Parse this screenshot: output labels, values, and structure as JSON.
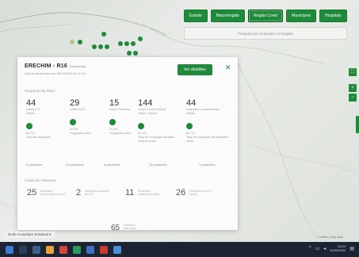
{
  "toolbar": {
    "buttons": [
      {
        "label": "Estado"
      },
      {
        "label": "Macrorregião"
      },
      {
        "label": "Região Covid"
      },
      {
        "label": "Municípios"
      },
      {
        "label": "Hospitais"
      }
    ],
    "active_index": 2
  },
  "search": {
    "placeholder": "Pesquise por município ou hospital"
  },
  "map_controls": {
    "fullscreen_icon": "fullscreen-icon",
    "zoom_in": "+",
    "zoom_out": "−"
  },
  "panel": {
    "title": "ERECHIM - R16",
    "title_note": "(hospitais)",
    "subtitle": "Dados atualizados em 00/00/0000 às 00:00",
    "details_button": "Ver detalhes",
    "close_icon": "close-icon",
    "section_beds": "Ocupação de leitos",
    "stats": [
      {
        "value": "44",
        "label": "Leitos UTI",
        "sub": "Adulto",
        "pct": "65,7%",
        "pct_label": "Taxa de ocupação"
      },
      {
        "value": "29",
        "label": "Leitos SUS",
        "sub": "",
        "pct": "62,9%",
        "pct_label": "Ocupação leitos"
      },
      {
        "value": "15",
        "label": "Leitos Privados",
        "sub": "",
        "pct": "47,2%",
        "pct_label": "Ocupação leitos"
      },
      {
        "value": "144",
        "label": "Leitos Covid Clínicos",
        "sub": "Todos / Adulto",
        "pct": "42,7%",
        "pct_label": "Taxa de ocupação de leitos clínicos covid"
      },
      {
        "value": "44",
        "label": "Suspeitos e confirmados",
        "sub": "Adulto",
        "pct": "30,7%",
        "pct_label": "Taxa de ocupação de pacientes covid"
      }
    ],
    "row_links": [
      "0 pacientes",
      "10 pacientes",
      "6 pacientes",
      "15 pacientes",
      "7 pacientes"
    ],
    "section_patients": "Covid-19: Pacientes",
    "patient_stats": [
      {
        "value": "25",
        "desc": "Pacientes confirmados em UTI"
      },
      {
        "value": "2",
        "desc": "Pacientes suspeitos em UTI"
      },
      {
        "value": "11",
        "desc": "Pacientes confirmados leitos"
      },
      {
        "value": "26",
        "desc": "Pacientes em UTI Adulto"
      }
    ],
    "bottom_stat": {
      "value": "65",
      "desc": "Pacientes internados"
    }
  },
  "footer": {
    "dropdown": "Rede Hospitalar Estadual",
    "attribution": "Leaflet | Map data"
  },
  "taskbar": {
    "clock_time": "09:23",
    "clock_date": "30/06/2020"
  },
  "colors": {
    "accent": "#1f8a3a",
    "taskbar": "#1c2434",
    "panel": "#fbfbfb"
  }
}
